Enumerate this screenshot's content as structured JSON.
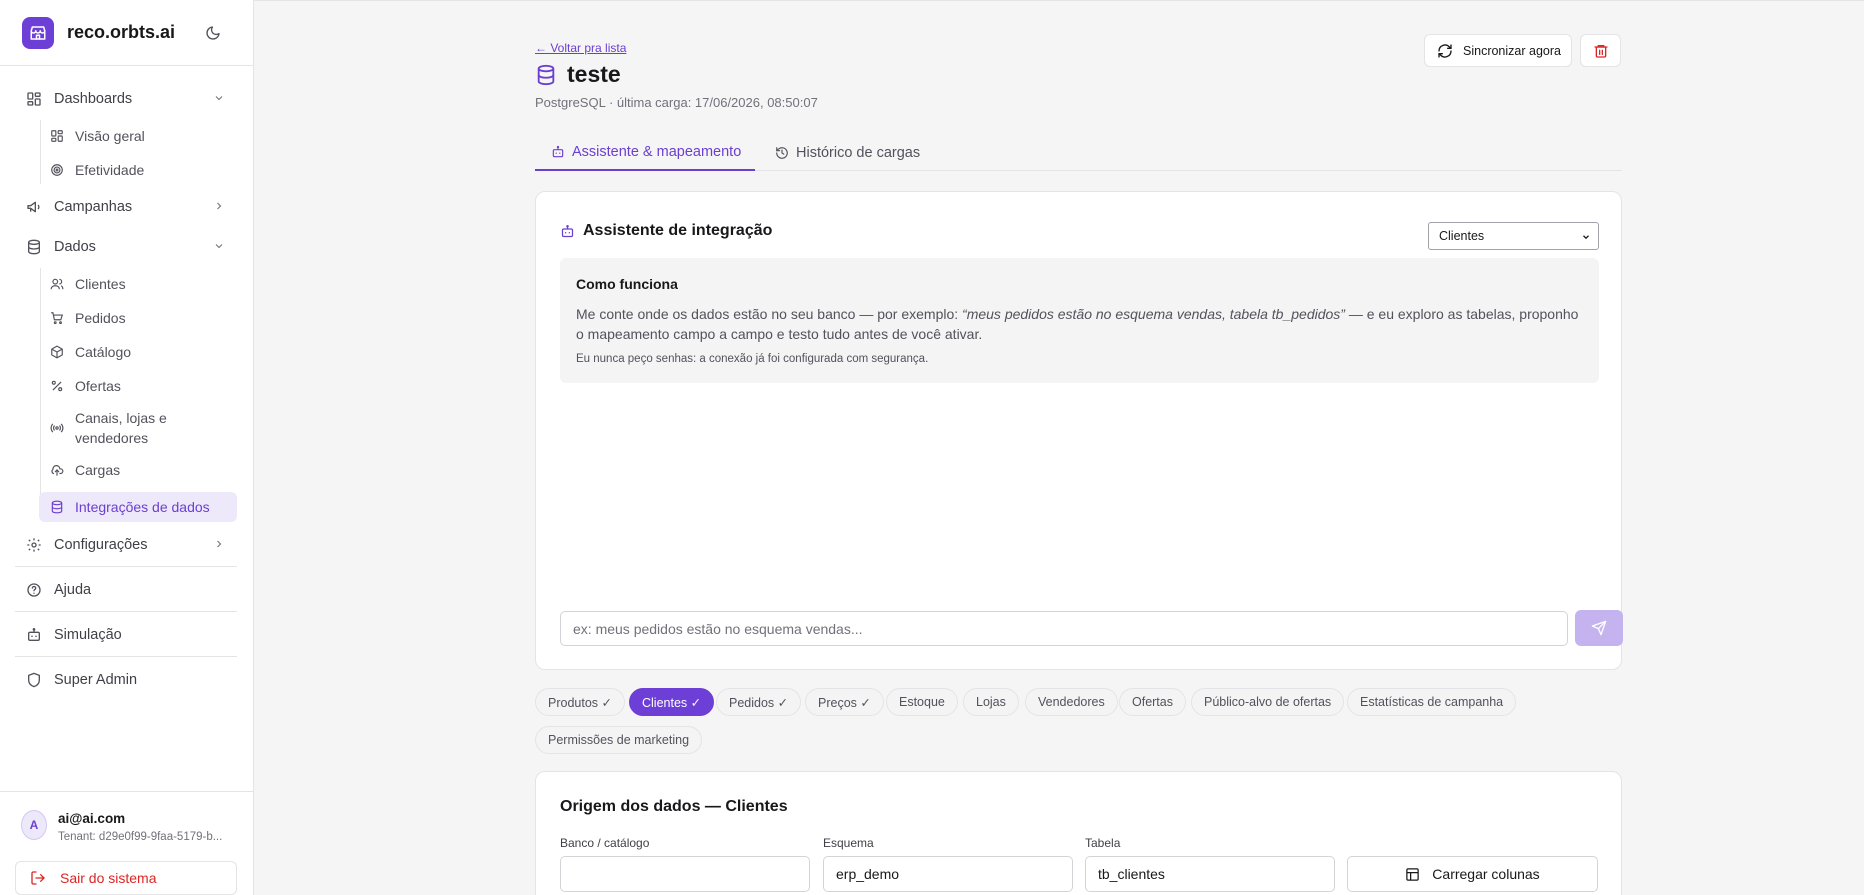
{
  "brand": {
    "name": "reco.orbts.ai"
  },
  "sidebar": {
    "dashboards": {
      "label": "Dashboards",
      "items": [
        "Visão geral",
        "Efetividade"
      ]
    },
    "campanhas": {
      "label": "Campanhas"
    },
    "dados": {
      "label": "Dados",
      "items": [
        "Clientes",
        "Pedidos",
        "Catálogo",
        "Ofertas",
        "Canais, lojas e vendedores",
        "Cargas",
        "Integrações de dados"
      ],
      "active": "Integrações de dados"
    },
    "configuracoes": {
      "label": "Configurações"
    },
    "ajuda": {
      "label": "Ajuda"
    },
    "simulacao": {
      "label": "Simulação"
    },
    "super_admin": {
      "label": "Super Admin"
    }
  },
  "user": {
    "avatar_letter": "A",
    "email": "ai@ai.com",
    "tenant": "Tenant: d29e0f99-9faa-5179-b...",
    "logout_label": "Sair do sistema"
  },
  "header": {
    "back_link": "← Voltar pra lista",
    "title": "teste",
    "subtitle": "PostgreSQL · última carga: 17/06/2026, 08:50:07",
    "sync_label": "Sincronizar agora"
  },
  "tabs": [
    {
      "label": "Assistente & mapeamento",
      "active": true
    },
    {
      "label": "Histórico de cargas",
      "active": false
    }
  ],
  "assistant": {
    "title": "Assistente de integração",
    "entity_selected": "Clientes",
    "info_title": "Como funciona",
    "info_text_1": "Me conte onde os dados estão no seu banco — por exemplo: ",
    "info_example": "“meus pedidos estão no esquema vendas, tabela tb_pedidos”",
    "info_text_2": " — e eu exploro as tabelas, proponho o mapeamento campo a campo e testo tudo antes de você ativar.",
    "info_note": "Eu nunca peço senhas: a conexão já foi configurada com segurança.",
    "input_placeholder": "ex: meus pedidos estão no esquema vendas..."
  },
  "chips": [
    {
      "label": "Produtos ✓",
      "active": false
    },
    {
      "label": "Clientes ✓",
      "active": true
    },
    {
      "label": "Pedidos ✓",
      "active": false
    },
    {
      "label": "Preços ✓",
      "active": false
    },
    {
      "label": "Estoque",
      "active": false
    },
    {
      "label": "Lojas",
      "active": false
    },
    {
      "label": "Vendedores",
      "active": false
    },
    {
      "label": "Ofertas",
      "active": false
    },
    {
      "label": "Público-alvo de ofertas",
      "active": false
    },
    {
      "label": "Estatísticas de campanha",
      "active": false
    },
    {
      "label": "Permissões de marketing",
      "active": false
    }
  ],
  "origin": {
    "title": "Origem dos dados — Clientes",
    "fields": [
      {
        "label": "Banco / catálogo",
        "value": ""
      },
      {
        "label": "Esquema",
        "value": "erp_demo"
      },
      {
        "label": "Tabela",
        "value": "tb_clientes"
      }
    ],
    "load_label": "Carregar colunas"
  },
  "colors": {
    "accent": "#6d3fd6",
    "accent_light": "#ede9fb",
    "danger": "#dc2626"
  }
}
